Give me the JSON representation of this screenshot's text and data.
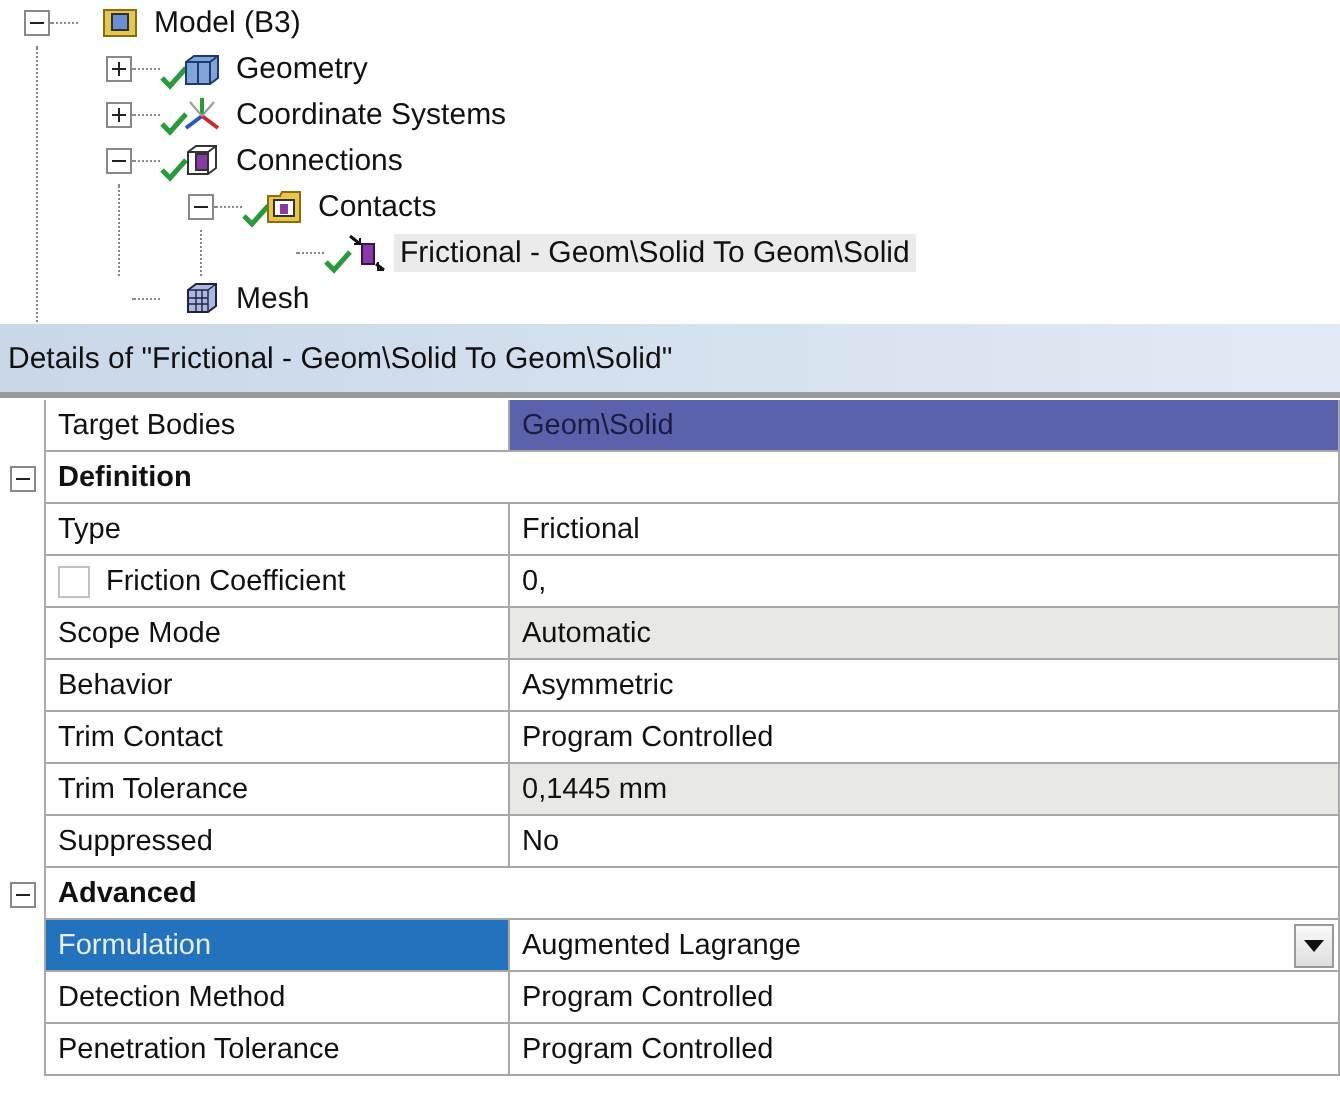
{
  "tree": {
    "label": "Model (B3)",
    "kind": "model",
    "expanded": true,
    "selected": false,
    "children": [
      {
        "label": "Geometry",
        "kind": "geometry",
        "expanded": false,
        "ok": true,
        "selected": false
      },
      {
        "label": "Coordinate Systems",
        "kind": "axes",
        "expanded": false,
        "ok": true,
        "selected": false
      },
      {
        "label": "Connections",
        "kind": "connections",
        "expanded": true,
        "ok": true,
        "selected": false,
        "children": [
          {
            "label": "Contacts",
            "kind": "folder",
            "expanded": true,
            "ok": true,
            "selected": false,
            "children": [
              {
                "label": "Frictional - Geom\\Solid To Geom\\Solid",
                "kind": "contact",
                "ok": true,
                "selected": true
              }
            ]
          }
        ]
      },
      {
        "label": "Mesh",
        "kind": "mesh",
        "selected": false
      }
    ]
  },
  "details": {
    "title": "Details of \"Frictional - Geom\\Solid To Geom\\Solid\"",
    "rows": [
      {
        "kind": "property",
        "name": "Target Bodies",
        "value": "Geom\\Solid",
        "value_highlighted": true,
        "readonly": false,
        "selected": false
      },
      {
        "kind": "section",
        "name": "Definition",
        "expanded": true
      },
      {
        "kind": "property",
        "name": "Type",
        "value": "Frictional",
        "value_highlighted": false,
        "readonly": false,
        "selected": false
      },
      {
        "kind": "property",
        "name": "Friction Coefficient",
        "value": "0,",
        "value_highlighted": false,
        "readonly": false,
        "selected": false,
        "checkbox": {
          "checked": false
        }
      },
      {
        "kind": "property",
        "name": "Scope Mode",
        "value": "Automatic",
        "value_highlighted": false,
        "readonly": true,
        "selected": false
      },
      {
        "kind": "property",
        "name": "Behavior",
        "value": "Asymmetric",
        "value_highlighted": false,
        "readonly": false,
        "selected": false
      },
      {
        "kind": "property",
        "name": "Trim Contact",
        "value": "Program Controlled",
        "value_highlighted": false,
        "readonly": false,
        "selected": false
      },
      {
        "kind": "property",
        "name": "Trim Tolerance",
        "value": "0,1445 mm",
        "value_highlighted": false,
        "readonly": true,
        "selected": false
      },
      {
        "kind": "property",
        "name": "Suppressed",
        "value": "No",
        "value_highlighted": false,
        "readonly": false,
        "selected": false
      },
      {
        "kind": "section",
        "name": "Advanced",
        "expanded": true
      },
      {
        "kind": "property",
        "name": "Formulation",
        "value": "Augmented Lagrange",
        "value_highlighted": false,
        "readonly": false,
        "selected": true,
        "dropdown": true
      },
      {
        "kind": "property",
        "name": "Detection Method",
        "value": "Program Controlled",
        "value_highlighted": false,
        "readonly": false,
        "selected": false
      },
      {
        "kind": "property",
        "name": "Penetration Tolerance",
        "value": "Program Controlled",
        "value_highlighted": false,
        "readonly": false,
        "selected": false
      }
    ]
  }
}
